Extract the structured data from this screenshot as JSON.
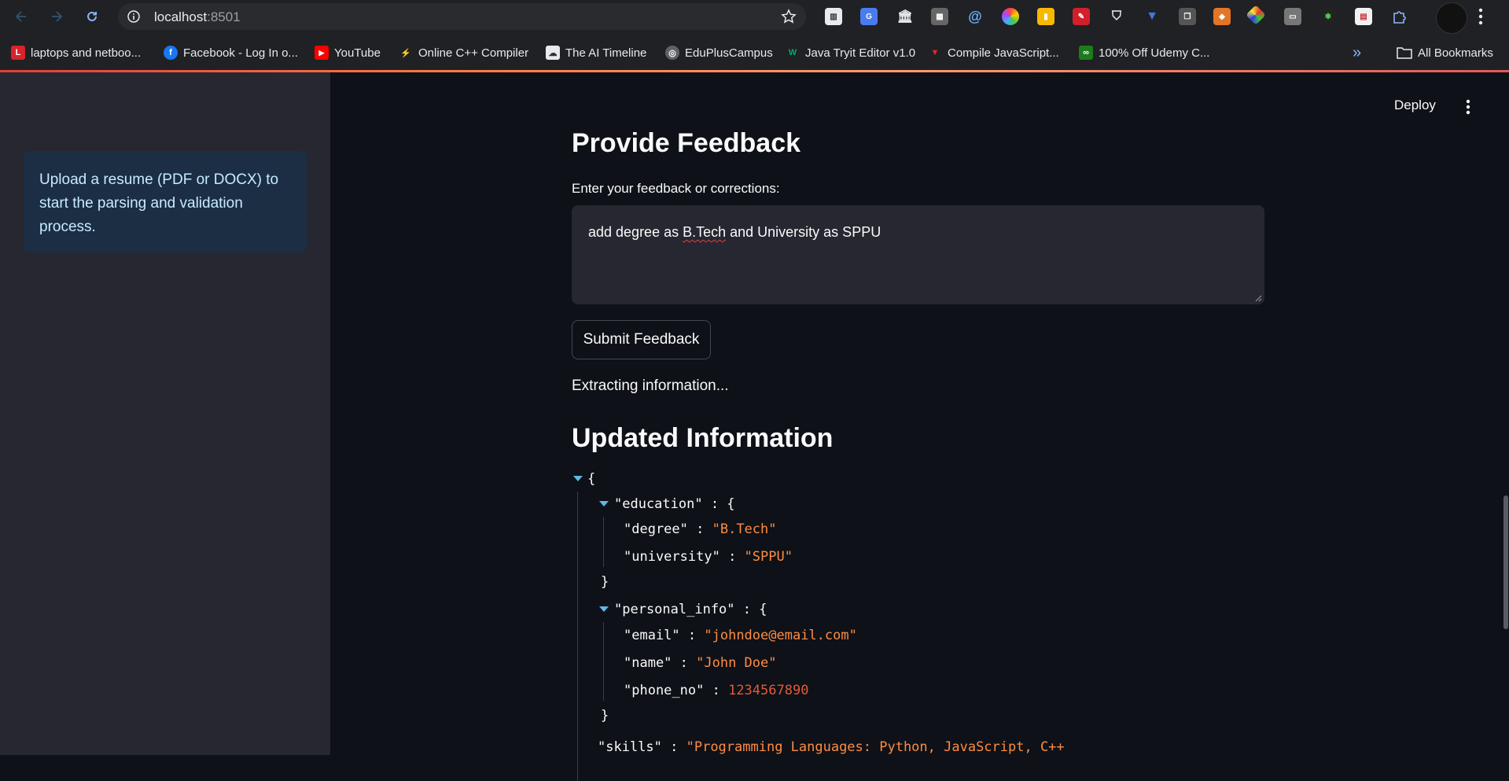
{
  "browser": {
    "url_host": "localhost",
    "url_port": ":8501",
    "bookmarks": [
      {
        "label": "laptops and netboo...",
        "icon": "L"
      },
      {
        "label": "Facebook - Log In o...",
        "icon": "f"
      },
      {
        "label": "YouTube",
        "icon": "▶"
      },
      {
        "label": "Online C++ Compiler",
        "icon": "⚡"
      },
      {
        "label": "The AI Timeline",
        "icon": "☁"
      },
      {
        "label": "EduPlusCampus",
        "icon": "◎"
      },
      {
        "label": "Java Tryit Editor v1.0",
        "icon": "W"
      },
      {
        "label": "Compile JavaScript...",
        "icon": "▼"
      },
      {
        "label": "100% Off Udemy C...",
        "icon": "∞"
      }
    ],
    "all_bookmarks": "All Bookmarks",
    "more_bookmarks": "»"
  },
  "sidebar": {
    "info": "Upload a resume (PDF or DOCX) to start the parsing and validation process."
  },
  "header": {
    "deploy": "Deploy"
  },
  "feedback": {
    "title": "Provide Feedback",
    "label": "Enter your feedback or corrections:",
    "text_before": "add degree as ",
    "text_spell": "B.Tech",
    "text_after": " and University as SPPU",
    "submit": "Submit Feedback",
    "status": "Extracting information..."
  },
  "updated": {
    "title": "Updated Information",
    "json": {
      "open_brace": "{",
      "education_key": "\"education\"",
      "degree_key": "\"degree\"",
      "degree_val": "\"B.Tech\"",
      "university_key": "\"university\"",
      "university_val": "\"SPPU\"",
      "personal_key": "\"personal_info\"",
      "email_key": "\"email\"",
      "email_val": "\"johndoe@email.com\"",
      "name_key": "\"name\"",
      "name_val": "\"John Doe\"",
      "phone_key": "\"phone_no\"",
      "phone_val": "1234567890",
      "skills_key": "\"skills\"",
      "skills_val": "\"Programming Languages: Python, JavaScript, C++"
    }
  },
  "colors": {
    "app_bg": "#0e1117",
    "sidebar_bg": "#262730",
    "info_bg": "#1c2e44",
    "string": "#ff8c42",
    "number": "#e05a3a",
    "toggle": "#5fb8e8"
  }
}
